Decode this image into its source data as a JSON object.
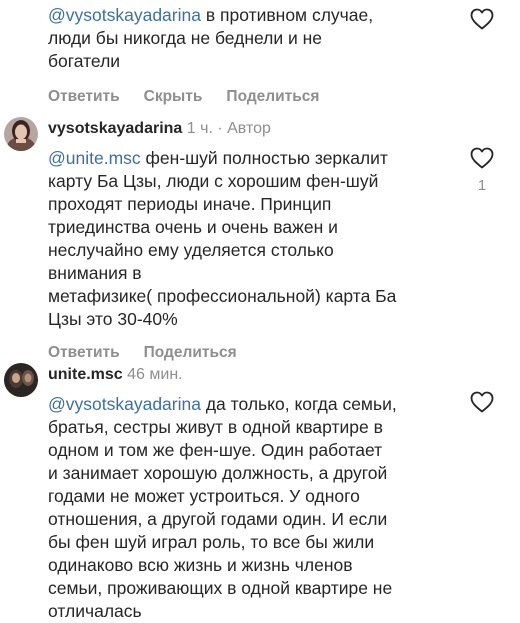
{
  "comments": [
    {
      "mention": "@vysotskayadarina",
      "lines": [
        " в противном случае,",
        "люди бы никогда не беднели и не",
        "богатели"
      ],
      "actions": [
        "Ответить",
        "Скрыть",
        "Поделиться"
      ],
      "icon": "heart-outline-icon"
    },
    {
      "username": "vysotskayadarina",
      "time": "1 ч.",
      "separator": "·",
      "role": "Автор",
      "mention": "@unite.msc",
      "lines": [
        " фен-шуй полностью зеркалит",
        "карту Ба Цзы, люди с хорошим фен-шуй",
        "проходят периоды иначе. Принцип",
        "триединства очень и очень важен и",
        "неслучайно ему уделяется столько",
        "внимания в",
        "метафизике( профессиональной) карта Ба",
        "Цзы это 30-40%"
      ],
      "actions": [
        "Ответить",
        "Поделиться"
      ],
      "likes": "1",
      "icon": "heart-outline-icon"
    },
    {
      "username": "unite.msc",
      "time": "46 мин.",
      "mention": "@vysotskayadarina",
      "lines": [
        " да только, когда семьи,",
        "братья, сестры живут в одной квартире в",
        "одном и том же фен-шуе. Один работает",
        "и занимает хорошую должность, а другой",
        "годами не может устроиться. У одного",
        "отношения, а другой годами один. И если",
        "бы фен шуй играл роль, то все бы жили",
        "одинаково всю жизнь и жизнь членов",
        "семьи, проживающих в одной квартире не",
        "отличалась"
      ],
      "icon": "heart-outline-icon"
    }
  ]
}
